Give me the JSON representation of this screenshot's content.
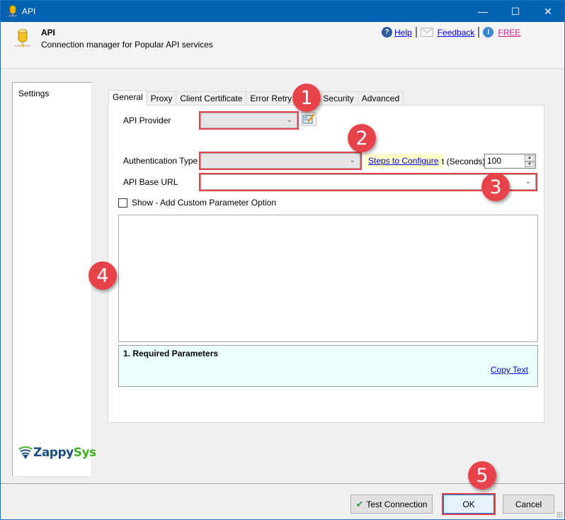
{
  "window": {
    "title": "API",
    "controls": {
      "minimize": "—",
      "maximize": "☐",
      "close": "✕"
    }
  },
  "header": {
    "title": "API",
    "subtitle": "Connection manager for Popular API services",
    "links": {
      "help": "Help",
      "feedback": "Feedback",
      "free": "FREE"
    },
    "icons": {
      "help": "?",
      "info": "i"
    }
  },
  "sidebar": {
    "label": "Settings",
    "logo": {
      "part1": "Zappy",
      "part2": "Sys"
    }
  },
  "tabs": [
    {
      "label": "General",
      "active": true
    },
    {
      "label": "Proxy",
      "active": false
    },
    {
      "label": "Client Certificate",
      "active": false
    },
    {
      "label": "Error Retry Settings",
      "visible_label": "Error Retr    gs",
      "active": false
    },
    {
      "label": "Security",
      "active": false
    },
    {
      "label": "Advanced",
      "active": false
    }
  ],
  "form": {
    "api_provider_label": "API Provider",
    "api_provider_value": "",
    "auth_type_label": "Authentication Type",
    "auth_type_value": "",
    "steps_link": "Steps to Configure",
    "timeout_label": "t (Seconds)",
    "timeout_value": "100",
    "base_url_label": "API Base URL",
    "base_url_value": "",
    "custom_param_checkbox": "Show - Add Custom Parameter Option",
    "custom_param_checked": false,
    "required_title": "1. Required Parameters",
    "copy_text": "Copy Text"
  },
  "footer": {
    "test_connection": "Test Connection",
    "ok": "OK",
    "cancel": "Cancel"
  },
  "annotations": [
    "1",
    "2",
    "3",
    "4",
    "5"
  ],
  "colors": {
    "titlebar": "#0063b1",
    "annotation": "#e8424b",
    "link": "#0000ee",
    "free_link": "#cc1f8f",
    "required_bg": "#ecffff",
    "steps_bg": "#ffffc8"
  }
}
